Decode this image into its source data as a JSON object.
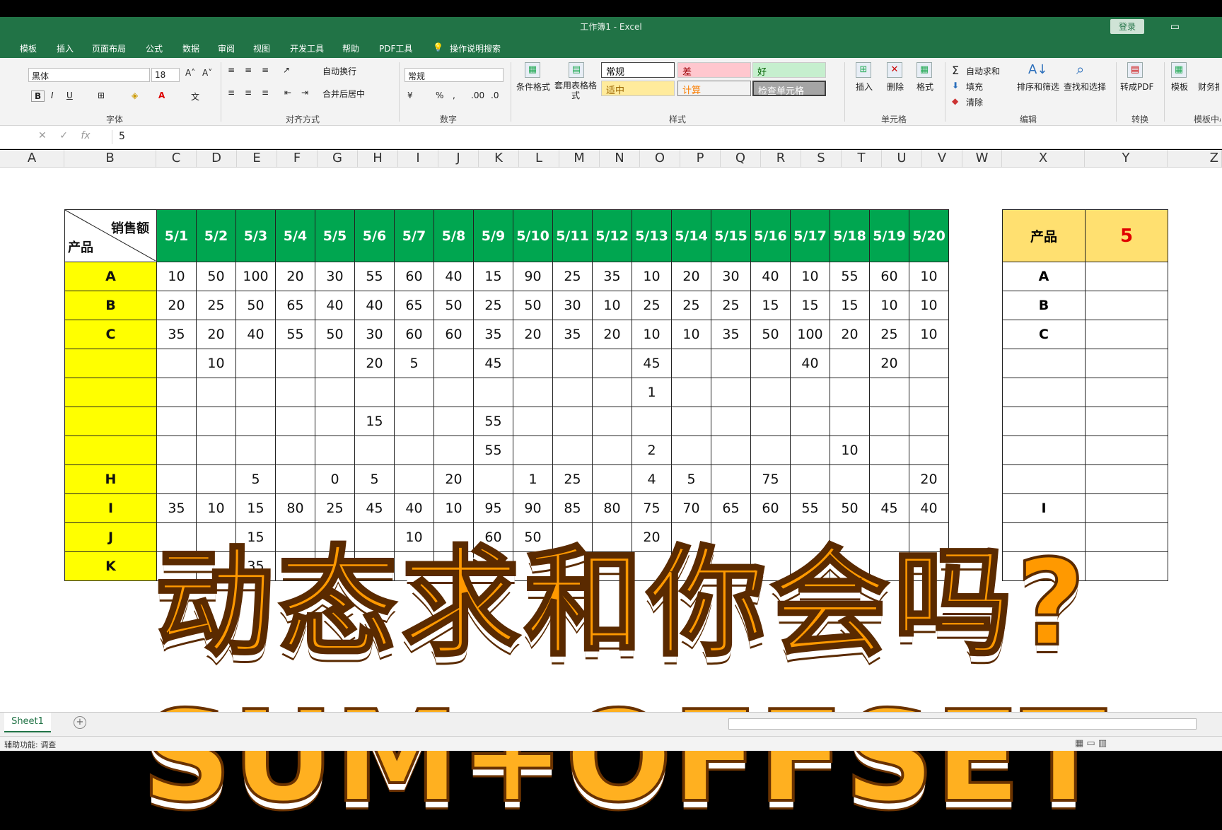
{
  "window": {
    "title": "工作簿1 - Excel",
    "login": "登录"
  },
  "tabs": [
    "模板",
    "插入",
    "页面布局",
    "公式",
    "数据",
    "审阅",
    "视图",
    "开发工具",
    "帮助",
    "PDF工具",
    "操作说明搜索"
  ],
  "font": {
    "name": "黑体",
    "size": "18",
    "group": "字体"
  },
  "alignment": {
    "wrap": "自动换行",
    "merge": "合并后居中",
    "group": "对齐方式"
  },
  "number": {
    "format": "常规",
    "group": "数字"
  },
  "styles": {
    "conditional": "条件格式",
    "table_format": "套用表格格式",
    "group": "样式",
    "normal": "常规",
    "bad": "差",
    "good": "好",
    "neutral": "适中",
    "calc": "计算",
    "check": "检查单元格"
  },
  "cells": {
    "insert": "插入",
    "delete": "删除",
    "format": "格式",
    "group": "单元格"
  },
  "editing": {
    "autosum": "自动求和",
    "fill": "填充",
    "clear": "清除",
    "sort": "排序和筛选",
    "find": "查找和选择",
    "group": "编辑"
  },
  "convert": {
    "pdf": "转成PDF",
    "group": "转换"
  },
  "templates": {
    "label": "模板",
    "report": "财务报表",
    "group": "模板中心"
  },
  "formula_bar": {
    "value": "5"
  },
  "columns": [
    "A",
    "B",
    "C",
    "D",
    "E",
    "F",
    "G",
    "H",
    "I",
    "J",
    "K",
    "L",
    "M",
    "N",
    "O",
    "P",
    "Q",
    "R",
    "S",
    "T",
    "U",
    "V",
    "W",
    "X",
    "Y",
    "Z"
  ],
  "main_table": {
    "corner_top": "销售额",
    "corner_bottom": "产品",
    "dates": [
      "5/1",
      "5/2",
      "5/3",
      "5/4",
      "5/5",
      "5/6",
      "5/7",
      "5/8",
      "5/9",
      "5/10",
      "5/11",
      "5/12",
      "5/13",
      "5/14",
      "5/15",
      "5/16",
      "5/17",
      "5/18",
      "5/19",
      "5/20"
    ],
    "rows": [
      {
        "label": "A",
        "values": [
          "10",
          "50",
          "100",
          "20",
          "30",
          "55",
          "60",
          "40",
          "15",
          "90",
          "25",
          "35",
          "10",
          "20",
          "30",
          "40",
          "10",
          "55",
          "60",
          "10"
        ]
      },
      {
        "label": "B",
        "values": [
          "20",
          "25",
          "50",
          "65",
          "40",
          "40",
          "65",
          "50",
          "25",
          "50",
          "30",
          "10",
          "25",
          "25",
          "25",
          "15",
          "15",
          "15",
          "10",
          "10"
        ]
      },
      {
        "label": "C",
        "values": [
          "35",
          "20",
          "40",
          "55",
          "50",
          "30",
          "60",
          "60",
          "35",
          "20",
          "35",
          "20",
          "10",
          "10",
          "35",
          "50",
          "100",
          "20",
          "25",
          "10"
        ]
      },
      {
        "label": "",
        "values": [
          "",
          "10",
          "",
          "",
          "",
          "20",
          "5",
          "",
          "45",
          "",
          "",
          "",
          "45",
          "",
          "",
          "",
          "40",
          "",
          "20",
          ""
        ]
      },
      {
        "label": "",
        "values": [
          "",
          "",
          "",
          "",
          "",
          "",
          "",
          "",
          "",
          "",
          "",
          "",
          "1",
          "",
          "",
          "",
          "",
          "",
          "",
          ""
        ]
      },
      {
        "label": "",
        "values": [
          "",
          "",
          "",
          "",
          "",
          "15",
          "",
          "",
          "55",
          "",
          "",
          "",
          "",
          "",
          "",
          "",
          "",
          "",
          "",
          ""
        ]
      },
      {
        "label": "",
        "values": [
          "",
          "",
          "",
          "",
          "",
          "",
          "",
          "",
          "55",
          "",
          "",
          "",
          "2",
          "",
          "",
          "",
          "",
          "10",
          "",
          ""
        ]
      },
      {
        "label": "H",
        "values": [
          "",
          "",
          "5",
          "",
          "0",
          "5",
          "",
          "20",
          "",
          "1",
          "25",
          "",
          "4",
          "5",
          "",
          "75",
          "",
          "",
          "",
          "20"
        ]
      },
      {
        "label": "I",
        "values": [
          "35",
          "10",
          "15",
          "80",
          "25",
          "45",
          "40",
          "10",
          "95",
          "90",
          "85",
          "80",
          "75",
          "70",
          "65",
          "60",
          "55",
          "50",
          "45",
          "40"
        ]
      },
      {
        "label": "J",
        "values": [
          "",
          "",
          "15",
          "",
          "",
          "",
          "10",
          "",
          "60",
          "50",
          "",
          "",
          "20",
          "",
          "",
          "",
          "",
          "",
          "",
          ""
        ]
      },
      {
        "label": "K",
        "values": [
          "",
          "",
          "35",
          "",
          "",
          "",
          "",
          "",
          "",
          "",
          "",
          "",
          "",
          "",
          "",
          "",
          "",
          "",
          "",
          ""
        ]
      }
    ]
  },
  "right_table": {
    "header": "产品",
    "value": "5",
    "rows": [
      "A",
      "B",
      "C",
      "",
      "",
      "",
      "",
      "",
      "I",
      "",
      ""
    ]
  },
  "overlay": {
    "line1": "动态求和你会吗?",
    "line2": "SUM+OFFSET"
  },
  "sheet_tab": "Sheet1",
  "status": "辅助功能: 调查"
}
